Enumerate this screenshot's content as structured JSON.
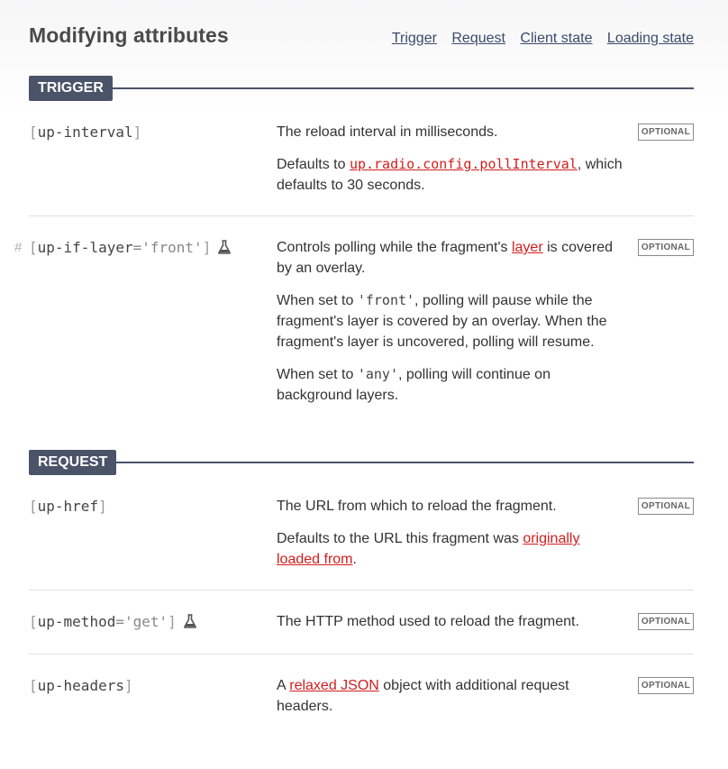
{
  "header": {
    "title": "Modifying attributes",
    "nav": [
      "Trigger",
      "Request",
      "Client state",
      "Loading state"
    ]
  },
  "sections": [
    {
      "label": "TRIGGER",
      "attrs": [
        {
          "name": "up-interval",
          "badge": "OPTIONAL",
          "desc1": "The reload interval in milliseconds.",
          "desc2_pre": "Defaults to ",
          "desc2_link": "up.radio.config.pollInterval",
          "desc2_post": ", which defaults to 30 seconds."
        },
        {
          "anchor": "#",
          "name": "up-if-layer",
          "eq": "=",
          "value": "'front'",
          "experimental_icon": "flask-icon",
          "badge": "OPTIONAL",
          "desc1_pre": "Controls polling while the fragment's ",
          "desc1_link": "layer",
          "desc1_post": " is covered by an overlay.",
          "desc2_pre": "When set to ",
          "desc2_code": "'front'",
          "desc2_post": ", polling will pause while the fragment's layer is covered by an overlay. When the fragment's layer is uncovered, polling will resume.",
          "desc3_pre": "When set to ",
          "desc3_code": "'any'",
          "desc3_post": ", polling will continue on background layers."
        }
      ]
    },
    {
      "label": "REQUEST",
      "attrs": [
        {
          "name": "up-href",
          "badge": "OPTIONAL",
          "desc1": "The URL from which to reload the fragment.",
          "desc2_pre": "Defaults to the URL this fragment was ",
          "desc2_link": "originally loaded from",
          "desc2_post": "."
        },
        {
          "name": "up-method",
          "eq": "=",
          "value": "'get'",
          "experimental_icon": "flask-icon",
          "badge": "OPTIONAL",
          "desc1": "The HTTP method used to reload the fragment."
        },
        {
          "name": "up-headers",
          "badge": "OPTIONAL",
          "desc1_pre": "A ",
          "desc1_link": "relaxed JSON",
          "desc1_post": " object with additional request headers."
        }
      ]
    }
  ],
  "brackets": {
    "open": "[",
    "close": "]"
  }
}
